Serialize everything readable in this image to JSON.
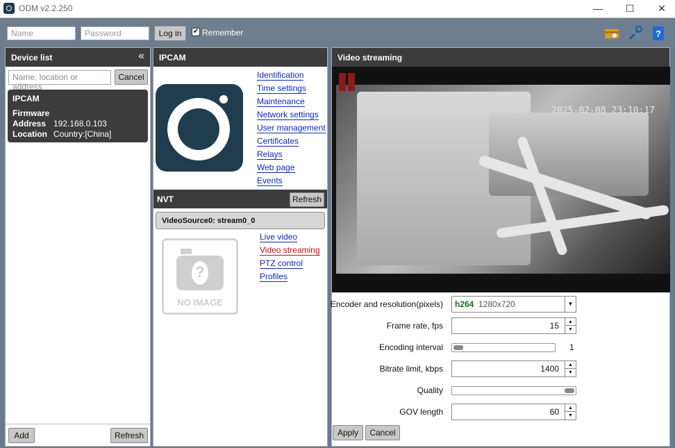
{
  "window": {
    "title": "ODM v2.2.250",
    "minimize": "—",
    "maximize": "☐",
    "close": "✕"
  },
  "login": {
    "name_placeholder": "Name",
    "password_placeholder": "Password",
    "login_label": "Log in",
    "remember_label": "Remember",
    "remember_checked": true
  },
  "device_list": {
    "title": "Device list",
    "collapse_icon": "«",
    "search_placeholder": "Name, location or address",
    "cancel_label": "Cancel",
    "devices": [
      {
        "name": "IPCAM",
        "firmware_label": "Firmware",
        "firmware": "",
        "address_label": "Address",
        "address": "192.168.0.103",
        "location_label": "Location",
        "location": "Country:[China]"
      }
    ],
    "add_label": "Add",
    "refresh_label": "Refresh"
  },
  "ipcam": {
    "title": "IPCAM",
    "links": [
      "Identification",
      "Time settings",
      "Maintenance",
      "Network settings",
      "User management",
      "Certificates",
      "Relays",
      "Web page",
      "Events"
    ],
    "nvt_title": "NVT",
    "nvt_refresh_label": "Refresh",
    "video_source": "VideoSource0: stream0_0",
    "no_image_text": "NO IMAGE",
    "source_links": [
      "Live video",
      "Video streaming",
      "PTZ control",
      "Profiles"
    ],
    "active_source_link": "Video streaming"
  },
  "streaming": {
    "title": "Video streaming",
    "timestamp": "2025-02-08  23:10:17",
    "encoder_label": "Encoder and resolution(pixels)",
    "encoder_codec": "h264",
    "encoder_resolution": "1280x720",
    "frame_rate_label": "Frame rate, fps",
    "frame_rate": "15",
    "encoding_interval_label": "Encoding interval",
    "encoding_interval": "1",
    "encoding_interval_level": 0.0,
    "bitrate_label": "Bitrate limit, kbps",
    "bitrate": "1400",
    "quality_label": "Quality",
    "quality_level": 1.0,
    "gov_label": "GOV length",
    "gov": "60",
    "apply_label": "Apply",
    "cancel_label": "Cancel"
  },
  "colors": {
    "header_bg": "#3c3c3c",
    "link": "#0a29b8",
    "active_link": "#c01010",
    "background": "#6e7e8f"
  }
}
